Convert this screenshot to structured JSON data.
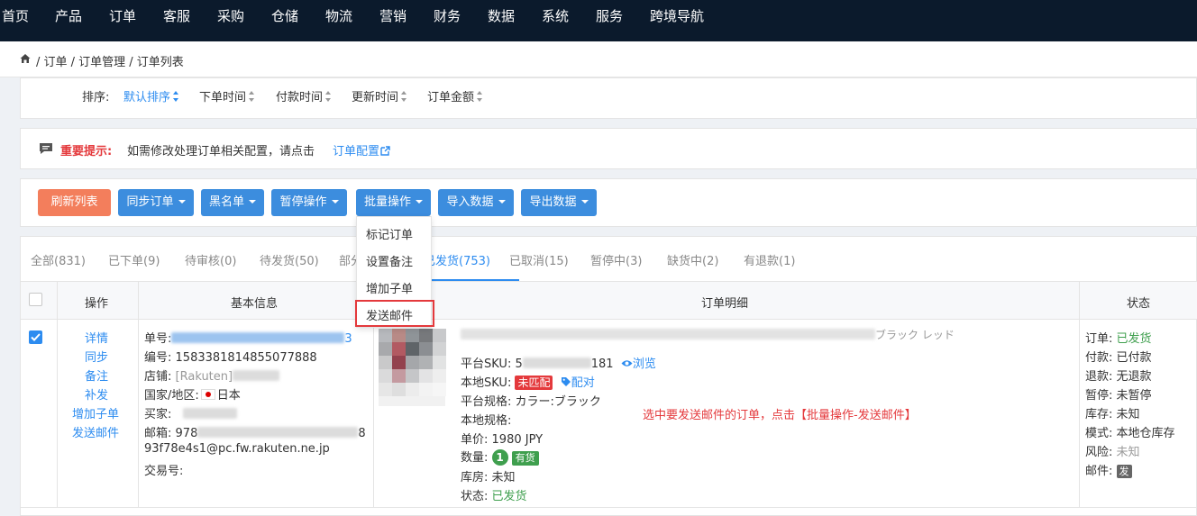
{
  "nav": [
    "首页",
    "产品",
    "订单",
    "客服",
    "采购",
    "仓储",
    "物流",
    "营销",
    "财务",
    "数据",
    "系统",
    "服务",
    "跨境导航"
  ],
  "breadcrumb": "/ 订单 / 订单管理 / 订单列表",
  "sort": {
    "label": "排序:",
    "items": [
      "默认排序",
      "下单时间",
      "付款时间",
      "更新时间",
      "订单金额"
    ]
  },
  "notice": {
    "label": "重要提示:",
    "text": "如需修改处理订单相关配置，请点击",
    "link": "订单配置"
  },
  "toolbar": {
    "refresh": "刷新列表",
    "sync": "同步订单",
    "blacklist": "黑名单",
    "pause": "暂停操作",
    "batch": "批量操作",
    "import": "导入数据",
    "export": "导出数据"
  },
  "tabs": [
    "全部(831)",
    "已下单(9)",
    "待审核(0)",
    "待发货(50)",
    "部分",
    "已发货(753)",
    "已取消(15)",
    "暂停中(3)",
    "缺货中(2)",
    "有退款(1)"
  ],
  "dropdown": [
    "标记订单",
    "设置备注",
    "增加子单",
    "发送邮件"
  ],
  "table": {
    "headers": {
      "ops": "操作",
      "basic": "基本信息",
      "detail": "订单明细",
      "status": "状态"
    },
    "row": {
      "ops": [
        "详情",
        "同步",
        "备注",
        "补发",
        "增加子单",
        "发送邮件"
      ],
      "basic": {
        "order_no_label": "单号:",
        "order_no_tail": "3",
        "serial_label": "编号:",
        "serial": "1583381814855077888",
        "shop_label": "店铺:",
        "shop": "[Rakuten]",
        "country_label": "国家/地区:",
        "country": "日本",
        "buyer_label": "买家:",
        "buyer_head": "　",
        "email_label": "邮箱:",
        "email_head": "978",
        "email_tail": "8",
        "email_line2": "93f78e4s1@pc.fw.rakuten.ne.jp",
        "trade_label": "交易号:"
      },
      "detail": {
        "title_tail": "ブラック レッド",
        "platform_sku_label": "平台SKU:",
        "platform_sku_head": "5",
        "platform_sku_tail": "181",
        "browse": "浏览",
        "local_sku_label": "本地SKU:",
        "unmatched": "未匹配",
        "match": "配对",
        "platform_spec_label": "平台规格:",
        "platform_spec": "カラー:ブラック",
        "local_spec_label": "本地规格:",
        "price_label": "单价:",
        "price": "1980 JPY",
        "qty_label": "数量:",
        "qty": "1",
        "in_stock": "有货",
        "warehouse_label": "库房:",
        "warehouse": "未知",
        "state_label": "状态:",
        "state": "已发货"
      },
      "annotation": "选中要发送邮件的订单，点击【批量操作-发送邮件】",
      "status": [
        {
          "label": "订单:",
          "value": "已发货"
        },
        {
          "label": "付款:",
          "value": "已付款"
        },
        {
          "label": "退款:",
          "value": "无退款"
        },
        {
          "label": "暂停:",
          "value": "未暂停"
        },
        {
          "label": "库存:",
          "value": "未知"
        },
        {
          "label": "模式:",
          "value": "本地仓库存"
        },
        {
          "label": "风险:",
          "value": "未知"
        },
        {
          "label": "邮件:",
          "value": "发"
        }
      ]
    }
  }
}
